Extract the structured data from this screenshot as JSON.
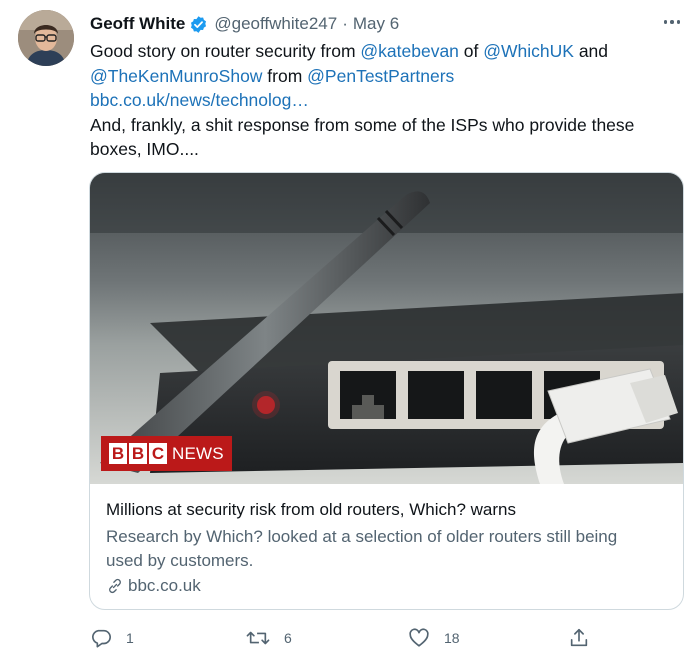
{
  "tweet": {
    "author_name": "Geoff White",
    "handle": "@geoffwhite247",
    "separator": "·",
    "date": "May 6",
    "body": {
      "l1_pre": "Good story on router security from ",
      "l1_m1": "@katebevan",
      "l1_mid": " of ",
      "l1_m2": "@WhichUK",
      "l1_post": " and",
      "l2_m1": "@TheKenMunroShow",
      "l2_mid": " from ",
      "l2_m2": "@PenTestPartners",
      "l3_link": "bbc.co.uk/news/technolog…",
      "l4": "And, frankly, a shit response from some of the ISPs who provide these",
      "l5": "boxes, IMO...."
    }
  },
  "card": {
    "logo_box_1": "B",
    "logo_box_2": "B",
    "logo_box_3": "C",
    "logo_news": "NEWS",
    "title": "Millions at security risk from old routers, Which? warns",
    "desc_l1": "Research by Which? looked at a selection of older routers still being",
    "desc_l2": "used by customers.",
    "domain": "bbc.co.uk"
  },
  "actions": {
    "reply_count": "1",
    "retweet_count": "6",
    "like_count": "18",
    "icons": [
      "reply-icon",
      "retweet-icon",
      "like-icon",
      "share-icon"
    ]
  },
  "colors": {
    "link": "#1d72b8",
    "secondary_text": "#536471",
    "verified": "#1d9bf0",
    "bbc_red": "#bb1919",
    "card_border": "#cfd9de"
  }
}
